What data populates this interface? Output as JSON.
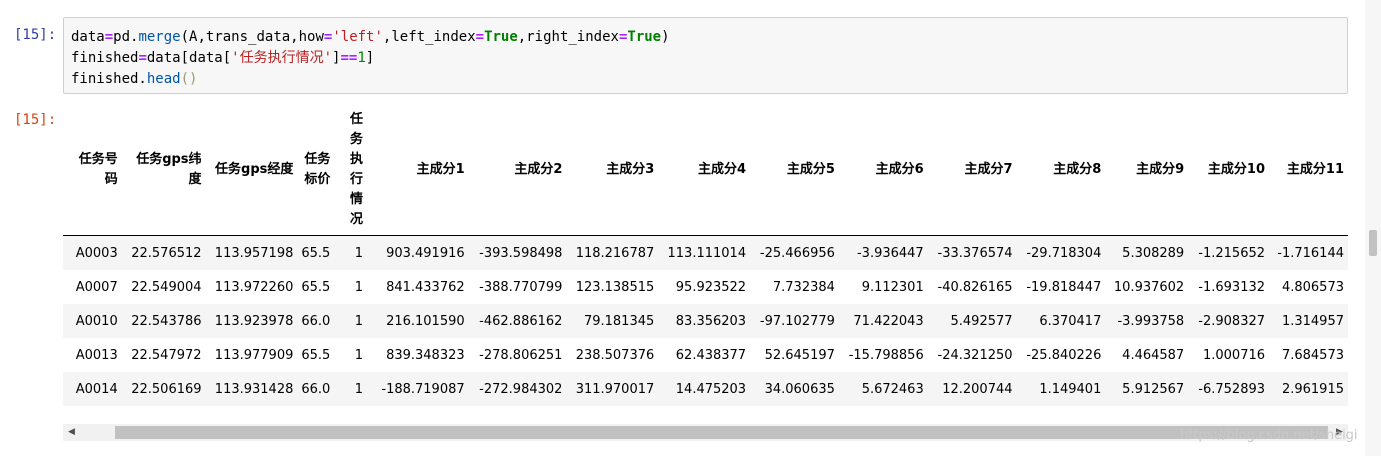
{
  "input_cell": {
    "prompt": "[15]:",
    "code_lines": [
      [
        {
          "t": "data",
          "c": ""
        },
        {
          "t": "=",
          "c": "cm-op"
        },
        {
          "t": "pd.",
          "c": ""
        },
        {
          "t": "merge",
          "c": "cm-method"
        },
        {
          "t": "(A,trans_data,how",
          "c": ""
        },
        {
          "t": "=",
          "c": "cm-op"
        },
        {
          "t": "'left'",
          "c": "cm-str"
        },
        {
          "t": ",left_index",
          "c": ""
        },
        {
          "t": "=",
          "c": "cm-op"
        },
        {
          "t": "True",
          "c": "cm-kw"
        },
        {
          "t": ",right_index",
          "c": ""
        },
        {
          "t": "=",
          "c": "cm-op"
        },
        {
          "t": "True",
          "c": "cm-kw"
        },
        {
          "t": ")",
          "c": ""
        }
      ],
      [
        {
          "t": "finished",
          "c": ""
        },
        {
          "t": "=",
          "c": "cm-op"
        },
        {
          "t": "data[data[",
          "c": ""
        },
        {
          "t": "'任务执行情况'",
          "c": "cm-str"
        },
        {
          "t": "]",
          "c": ""
        },
        {
          "t": "==",
          "c": "cm-op"
        },
        {
          "t": "1",
          "c": "cm-num"
        },
        {
          "t": "]",
          "c": ""
        }
      ],
      [
        {
          "t": "finished.",
          "c": ""
        },
        {
          "t": "head",
          "c": "cm-method"
        },
        {
          "t": "()",
          "c": "cm-paren"
        }
      ]
    ]
  },
  "output_cell": {
    "prompt": "[15]:",
    "columns": [
      "任务号码",
      "任务gps纬度",
      "任务gps经度",
      "任务标价",
      "任务执行情况",
      "主成分1",
      "主成分2",
      "主成分3",
      "主成分4",
      "主成分5",
      "主成分6",
      "主成分7",
      "主成分8",
      "主成分9",
      "主成分10",
      "主成分11"
    ],
    "rows": [
      [
        "A0003",
        "22.576512",
        "113.957198",
        "65.5",
        "1",
        "903.491916",
        "-393.598498",
        "118.216787",
        "113.111014",
        "-25.466956",
        "-3.936447",
        "-33.376574",
        "-29.718304",
        "5.308289",
        "-1.215652",
        "-1.716144"
      ],
      [
        "A0007",
        "22.549004",
        "113.972260",
        "65.5",
        "1",
        "841.433762",
        "-388.770799",
        "123.138515",
        "95.923522",
        "7.732384",
        "9.112301",
        "-40.826165",
        "-19.818447",
        "10.937602",
        "-1.693132",
        "4.806573"
      ],
      [
        "A0010",
        "22.543786",
        "113.923978",
        "66.0",
        "1",
        "216.101590",
        "-462.886162",
        "79.181345",
        "83.356203",
        "-97.102779",
        "71.422043",
        "5.492577",
        "6.370417",
        "-3.993758",
        "-2.908327",
        "1.314957"
      ],
      [
        "A0013",
        "22.547972",
        "113.977909",
        "65.5",
        "1",
        "839.348323",
        "-278.806251",
        "238.507376",
        "62.438377",
        "52.645197",
        "-15.798856",
        "-24.321250",
        "-25.840226",
        "4.464587",
        "1.000716",
        "7.684573"
      ],
      [
        "A0014",
        "22.506169",
        "113.931428",
        "66.0",
        "1",
        "-188.719087",
        "-272.984302",
        "311.970017",
        "14.475203",
        "34.060635",
        "5.672463",
        "12.200744",
        "1.149401",
        "5.912567",
        "-6.752893",
        "2.961915"
      ]
    ]
  },
  "scrollbar": {
    "left_arrow": "◀",
    "right_arrow": "▶"
  },
  "watermark": "https://blog.csdn.net/sheigi"
}
